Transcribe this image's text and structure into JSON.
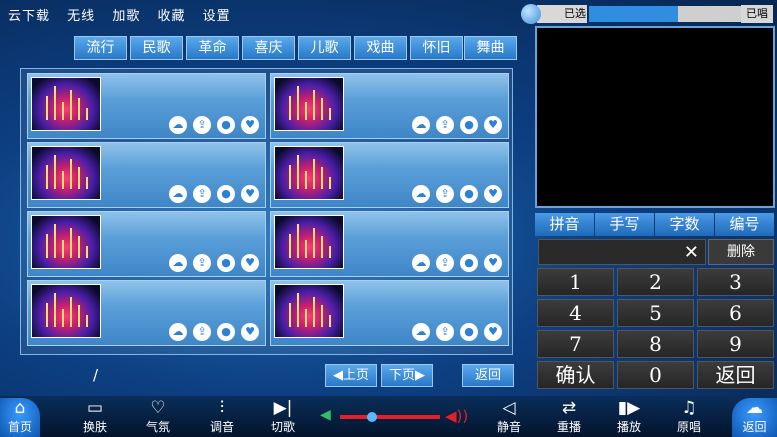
{
  "top_menu": [
    "云下载",
    "无线",
    "加歌",
    "收藏",
    "设置"
  ],
  "categories": [
    "流行",
    "民歌",
    "革命",
    "喜庆",
    "儿歌",
    "戏曲",
    "怀旧",
    "舞曲"
  ],
  "song_cards": [
    {
      "title": ""
    },
    {
      "title": ""
    },
    {
      "title": ""
    },
    {
      "title": ""
    },
    {
      "title": ""
    },
    {
      "title": ""
    },
    {
      "title": ""
    },
    {
      "title": ""
    }
  ],
  "card_icons": [
    "cloud-icon",
    "top-icon",
    "singer-icon",
    "heart-icon"
  ],
  "page_indicator": "/",
  "pager": {
    "prev": "上页",
    "next": "下页",
    "back": "返回"
  },
  "selected": {
    "label": "已选",
    "sung_label": "已唱",
    "progress": 0.52
  },
  "input_tabs": [
    "拼音",
    "手写",
    "字数",
    "编号"
  ],
  "keypad": {
    "clear": "✕",
    "delete": "删除",
    "keys": [
      "1",
      "2",
      "3",
      "4",
      "5",
      "6",
      "7",
      "8",
      "9",
      "确认",
      "0",
      "返回"
    ]
  },
  "bottom_bar": [
    {
      "label": "首页",
      "icon": "home-icon",
      "selected": true
    },
    {
      "label": "换肤",
      "icon": "skin-icon"
    },
    {
      "label": "气氛",
      "icon": "mood-icon"
    },
    {
      "label": "调音",
      "icon": "tuning-icon"
    },
    {
      "label": "切歌",
      "icon": "skip-icon"
    },
    {
      "label": "静音",
      "icon": "mute-icon"
    },
    {
      "label": "重播",
      "icon": "replay-icon"
    },
    {
      "label": "播放",
      "icon": "play-icon"
    },
    {
      "label": "原唱",
      "icon": "original-icon"
    },
    {
      "label": "返回",
      "icon": "back-icon",
      "selected": true
    }
  ],
  "volume": 0.32,
  "colors": {
    "accent": "#2f8ee0",
    "volume_fill": "#e0202a",
    "volume_low": "#2ec26a"
  }
}
